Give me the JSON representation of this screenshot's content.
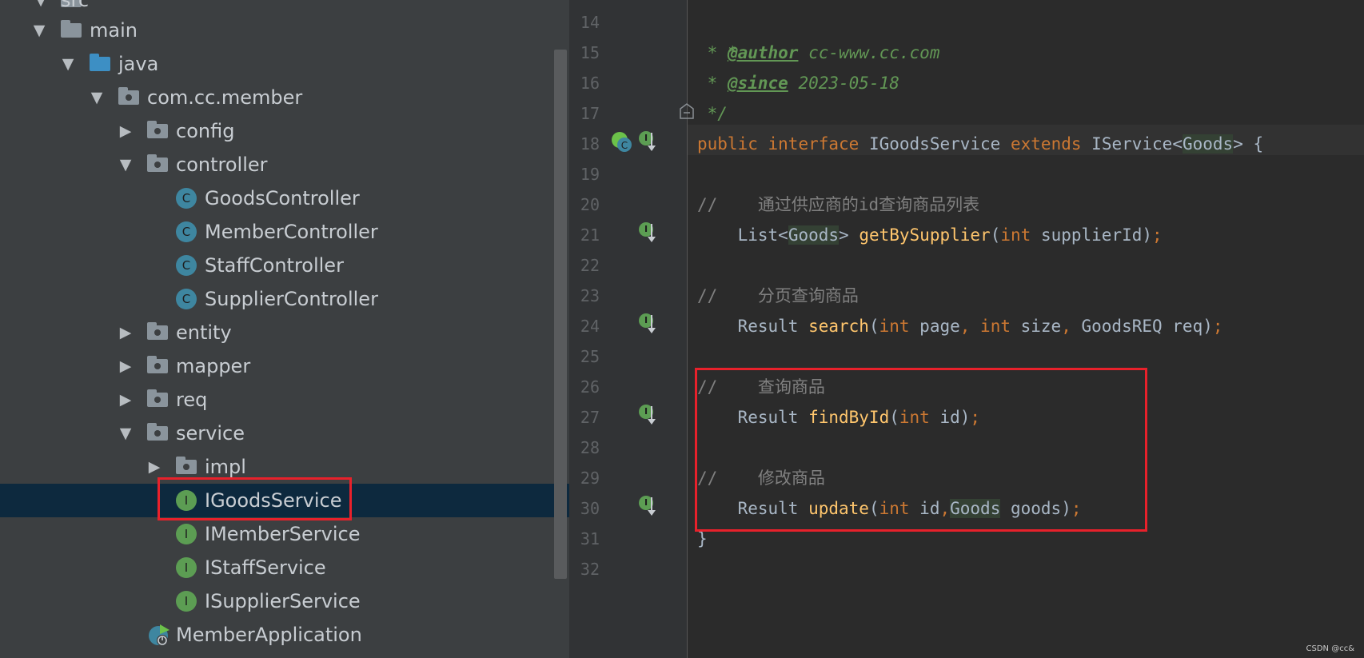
{
  "tree": {
    "items": [
      {
        "label": "src",
        "kind": "folder"
      },
      {
        "label": "main",
        "kind": "folder"
      },
      {
        "label": "java",
        "kind": "source-folder"
      },
      {
        "label": "com.cc.member",
        "kind": "package"
      },
      {
        "label": "config",
        "kind": "package"
      },
      {
        "label": "controller",
        "kind": "package"
      },
      {
        "label": "GoodsController",
        "kind": "class",
        "icon_letter": "C"
      },
      {
        "label": "MemberController",
        "kind": "class",
        "icon_letter": "C"
      },
      {
        "label": "StaffController",
        "kind": "class",
        "icon_letter": "C"
      },
      {
        "label": "SupplierController",
        "kind": "class",
        "icon_letter": "C"
      },
      {
        "label": "entity",
        "kind": "package"
      },
      {
        "label": "mapper",
        "kind": "package"
      },
      {
        "label": "req",
        "kind": "package"
      },
      {
        "label": "service",
        "kind": "package"
      },
      {
        "label": "impl",
        "kind": "package"
      },
      {
        "label": "IGoodsService",
        "kind": "interface",
        "icon_letter": "I",
        "selected": true
      },
      {
        "label": "IMemberService",
        "kind": "interface",
        "icon_letter": "I"
      },
      {
        "label": "IStaffService",
        "kind": "interface",
        "icon_letter": "I"
      },
      {
        "label": "ISupplierService",
        "kind": "interface",
        "icon_letter": "I"
      },
      {
        "label": "MemberApplication",
        "kind": "spring-app"
      }
    ]
  },
  "editor": {
    "line_numbers": [
      "14",
      "15",
      "16",
      "17",
      "18",
      "19",
      "20",
      "21",
      "22",
      "23",
      "24",
      "25",
      "26",
      "27",
      "28",
      "29",
      "30",
      "31",
      "32"
    ],
    "gutter_icon_letter": "I",
    "spring_icon_letter": "C",
    "lines": {
      "l14": {
        "star": " *"
      },
      "l15": {
        "star": " * ",
        "tag": "@author",
        "text": " cc-www.cc.com"
      },
      "l16": {
        "star": " * ",
        "tag": "@since",
        "text": " 2023-05-18"
      },
      "l17": {
        "end": " */"
      },
      "l18": {
        "kw1": "public",
        "kw2": "interface",
        "name": "IGoodsService",
        "kw3": "extends",
        "base": "IService",
        "lt": "<",
        "generic": "Goods",
        "gt": ">",
        "brace": " {"
      },
      "l20": {
        "comment": "//    通过供应商的id查询商品列表"
      },
      "l21": {
        "type": "    List",
        "lt": "<",
        "generic": "Goods",
        "gt": "> ",
        "method": "getBySupplier",
        "open": "(",
        "ptype": "int",
        "pname": " supplierId",
        "close": ")",
        "semi": ";"
      },
      "l23": {
        "comment": "//    分页查询商品"
      },
      "l24": {
        "type": "    Result ",
        "method": "search",
        "open": "(",
        "p1type": "int",
        "p1name": " page",
        "c1": ", ",
        "p2type": "int",
        "p2name": " size",
        "c2": ", ",
        "p3": "GoodsREQ req",
        "close": ")",
        "semi": ";"
      },
      "l26": {
        "comment": "//    查询商品"
      },
      "l27": {
        "type": "    Result ",
        "method": "findById",
        "open": "(",
        "ptype": "int",
        "pname": " id",
        "close": ")",
        "semi": ";"
      },
      "l29": {
        "comment": "//    修改商品"
      },
      "l30": {
        "type": "    Result ",
        "method": "update",
        "open": "(",
        "ptype": "int",
        "pname": " id",
        "comma": ",",
        "generic": "Goods",
        "rest": " goods",
        "close": ")",
        "semi": ";"
      },
      "l31": {
        "brace": "}"
      }
    }
  },
  "watermark": "CSDN @cc&",
  "colors": {
    "highlight_box": "#e8212b",
    "keyword": "#cc7832",
    "method": "#ffc66d",
    "doc": "#629755",
    "comment": "#808080"
  }
}
